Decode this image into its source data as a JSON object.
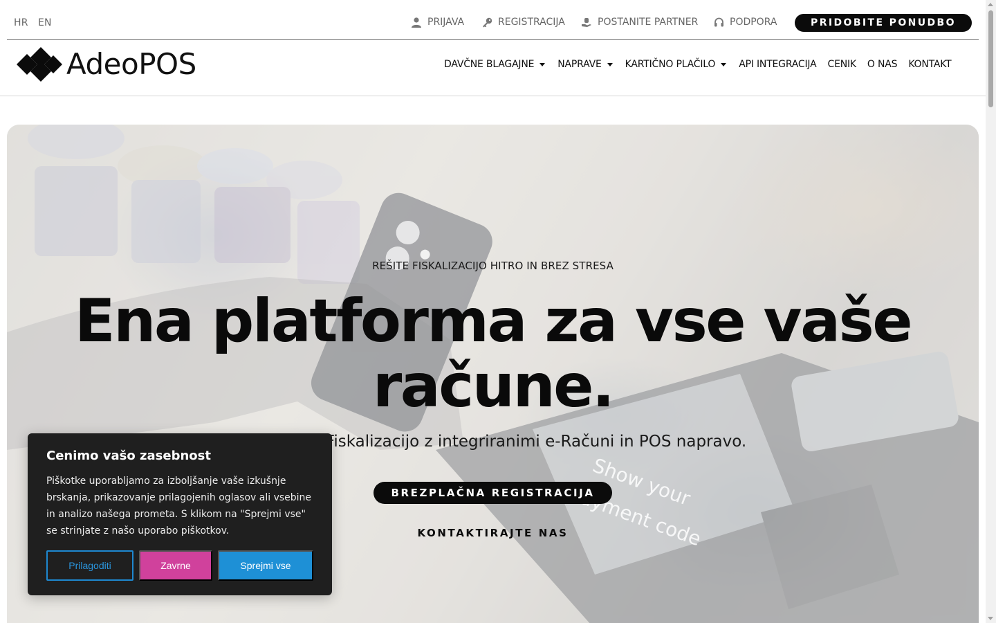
{
  "topbar": {
    "languages": [
      "HR",
      "EN"
    ],
    "links": {
      "login": "PRIJAVA",
      "register": "REGISTRACIJA",
      "partner": "POSTANITE PARTNER",
      "support": "PODPORA"
    },
    "offer_button": "PRIDOBITE PONUDBO"
  },
  "header": {
    "logo_text": "AdeoPOS",
    "nav": [
      {
        "label": "DAVČNE BLAGAJNE",
        "dropdown": true
      },
      {
        "label": "NAPRAVE",
        "dropdown": true
      },
      {
        "label": "KARTIČNO PLAČILO",
        "dropdown": true
      },
      {
        "label": "API INTEGRACIJA",
        "dropdown": false
      },
      {
        "label": "CENIK",
        "dropdown": false
      },
      {
        "label": "O NAS",
        "dropdown": false
      },
      {
        "label": "KONTAKT",
        "dropdown": false
      }
    ]
  },
  "hero": {
    "eyebrow": "REŠITE FISKALIZACIJO HITRO IN BREZ STRESA",
    "title_line1": "Ena platforma za vse vaše",
    "title_line2": "račune.",
    "subtitle": "Rešitev za Fiskalizacijo z integriranimi e-Računi in POS napravo.",
    "cta_primary": "BREZPLAČNA REGISTRACIJA",
    "cta_secondary": "KONTAKTIRAJTE NAS",
    "screen_text_line1": "Show your",
    "screen_text_line2": "payment code"
  },
  "cookie_banner": {
    "title": "Cenimo vašo zasebnost",
    "text": "Piškotke uporabljamo za izboljšanje vaše izkušnje brskanja, prikazovanje prilagojenih oglasov ali vsebine in analizo našega prometa. S klikom na \"Sprejmi vse\" se strinjate z našo uporabo piškotkov.",
    "buttons": {
      "customize": "Prilagoditi",
      "reject": "Zavrne",
      "accept": "Sprejmi vse"
    }
  },
  "colors": {
    "primary_dark": "#0b0b0b",
    "cookie_bg": "#1f1f1f",
    "reject_pink": "#d0419c",
    "accept_blue": "#1e90d6"
  },
  "icons": {
    "login": "user-icon",
    "register": "key-icon",
    "partner": "handshake-icon",
    "support": "headset-icon",
    "nav_dropdown": "caret-down-icon"
  }
}
